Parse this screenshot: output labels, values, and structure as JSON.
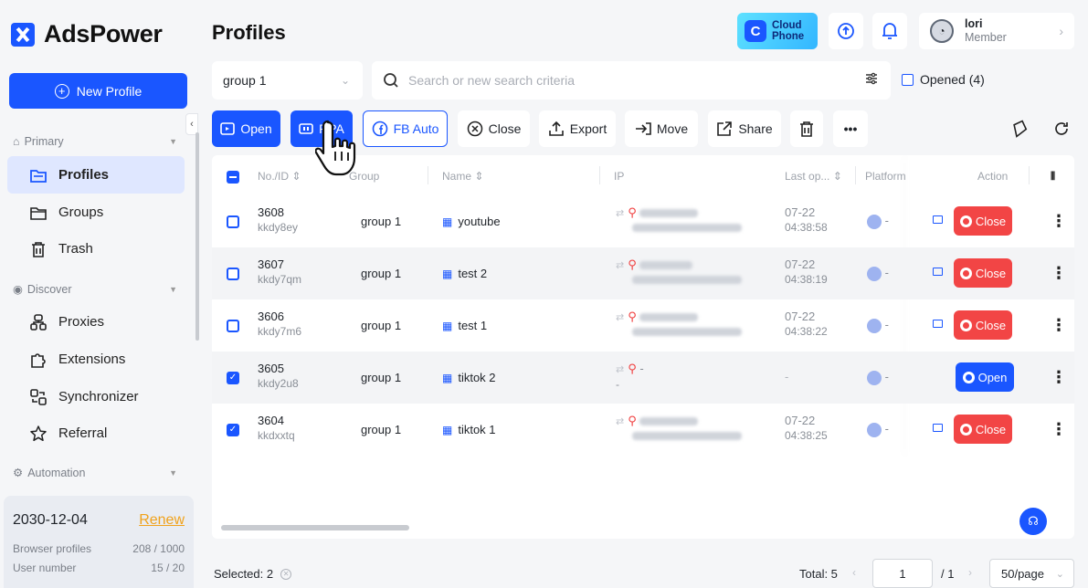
{
  "brand": {
    "name": "AdsPower"
  },
  "sidebar": {
    "new_profile": "New Profile",
    "sections": {
      "primary": "Primary",
      "discover": "Discover",
      "automation": "Automation"
    },
    "items": [
      {
        "label": "Profiles",
        "icon": "folder-icon",
        "active": true
      },
      {
        "label": "Groups",
        "icon": "folder-outline-icon"
      },
      {
        "label": "Trash",
        "icon": "trash-icon"
      },
      {
        "label": "Proxies",
        "icon": "proxies-icon"
      },
      {
        "label": "Extensions",
        "icon": "puzzle-icon"
      },
      {
        "label": "Synchronizer",
        "icon": "synchronizer-icon"
      },
      {
        "label": "Referral",
        "icon": "star-icon"
      }
    ],
    "plan": {
      "expiry": "2030-12-04",
      "renew": "Renew",
      "browser_profiles_label": "Browser profiles",
      "browser_profiles_value": "208 / 1000",
      "user_number_label": "User number",
      "user_number_value": "15 / 20"
    }
  },
  "header": {
    "title": "Profiles",
    "cloud_phone_line1": "Cloud",
    "cloud_phone_line2": "Phone",
    "user": {
      "name": "lori",
      "role": "Member"
    }
  },
  "filters": {
    "group": "group 1",
    "search_placeholder": "Search or new search criteria",
    "opened_label": "Opened (4)"
  },
  "toolbar": {
    "open": "Open",
    "rpa": "RPA",
    "fb_auto": "FB Auto",
    "close": "Close",
    "export": "Export",
    "move": "Move",
    "share": "Share",
    "more": "•••"
  },
  "table": {
    "columns": {
      "no_id": "No./ID",
      "group": "Group",
      "name": "Name",
      "ip": "IP",
      "last_opened": "Last op...",
      "platform": "Platform",
      "action": "Action"
    },
    "rows": [
      {
        "no": "3608",
        "id": "kkdy8ey",
        "group": "group 1",
        "name": "youtube",
        "ip_blurred": true,
        "last_date": "07-22",
        "last_time": "04:38:58",
        "platform": "-",
        "action": "Close",
        "checked": false
      },
      {
        "no": "3607",
        "id": "kkdy7qm",
        "group": "group 1",
        "name": "test 2",
        "ip_blurred": true,
        "last_date": "07-22",
        "last_time": "04:38:19",
        "platform": "-",
        "action": "Close",
        "checked": false
      },
      {
        "no": "3606",
        "id": "kkdy7m6",
        "group": "group 1",
        "name": "test 1",
        "ip_blurred": true,
        "last_date": "07-22",
        "last_time": "04:38:22",
        "platform": "-",
        "action": "Close",
        "checked": false
      },
      {
        "no": "3605",
        "id": "kkdy2u8",
        "group": "group 1",
        "name": "tiktok 2",
        "ip_blurred": false,
        "ip_text": "-",
        "ip_sub": "-",
        "last_date": "-",
        "last_time": "",
        "platform": "-",
        "action": "Open",
        "checked": true
      },
      {
        "no": "3604",
        "id": "kkdxxtq",
        "group": "group 1",
        "name": "tiktok 1",
        "ip_blurred": true,
        "last_date": "07-22",
        "last_time": "04:38:25",
        "platform": "-",
        "action": "Close",
        "checked": true
      }
    ]
  },
  "footer": {
    "selected": "Selected: 2",
    "total": "Total: 5",
    "page": "1",
    "page_of": "/ 1",
    "per_page": "50/page"
  },
  "colors": {
    "accent": "#1a56ff",
    "danger": "#f24545",
    "renew": "#f0a21c"
  }
}
